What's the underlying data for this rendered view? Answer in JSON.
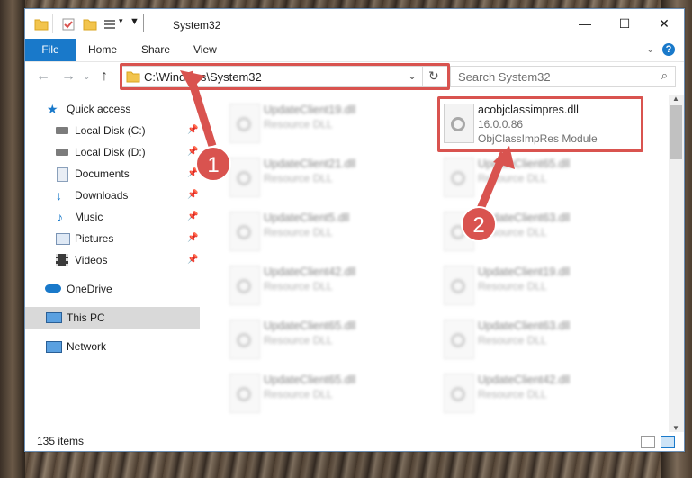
{
  "window": {
    "title": "System32"
  },
  "ribbon": {
    "tabs": [
      "File",
      "Home",
      "Share",
      "View"
    ]
  },
  "address": {
    "path": "C:\\Windows\\System32"
  },
  "search": {
    "placeholder": "Search System32"
  },
  "nav": {
    "items": [
      {
        "label": "Quick access",
        "icon": "star-icon",
        "color": "#1979ca"
      },
      {
        "label": "Local Disk (C:)",
        "icon": "drive-icon",
        "pinned": true
      },
      {
        "label": "Local Disk (D:)",
        "icon": "drive-icon",
        "pinned": true
      },
      {
        "label": "Documents",
        "icon": "documents-icon",
        "pinned": true
      },
      {
        "label": "Downloads",
        "icon": "downloads-icon",
        "pinned": true
      },
      {
        "label": "Music",
        "icon": "music-icon",
        "pinned": true
      },
      {
        "label": "Pictures",
        "icon": "pictures-icon",
        "pinned": true
      },
      {
        "label": "Videos",
        "icon": "videos-icon",
        "pinned": true
      },
      {
        "label": "OneDrive",
        "icon": "cloud-icon"
      },
      {
        "label": "This PC",
        "icon": "computer-icon",
        "selected": true
      },
      {
        "label": "Network",
        "icon": "network-icon"
      }
    ]
  },
  "files": [
    {
      "name": "UpdateClient19.dll",
      "desc": "Resource DLL"
    },
    {
      "name": "acobjclassimpres.dll",
      "version": "16.0.0.86",
      "desc": "ObjClassImpRes Module"
    },
    {
      "name": "UpdateClient21.dll",
      "desc": "Resource DLL"
    },
    {
      "name": "UpdateClient65.dll",
      "desc": "Resource DLL"
    },
    {
      "name": "UpdateClient5.dll",
      "desc": "Resource DLL"
    },
    {
      "name": "UpdateClient63.dll",
      "desc": "Resource DLL"
    },
    {
      "name": "UpdateClient42.dll",
      "desc": "Resource DLL"
    },
    {
      "name": "UpdateClient19.dll",
      "desc": "Resource DLL"
    },
    {
      "name": "UpdateClient65.dll",
      "desc": "Resource DLL"
    },
    {
      "name": "UpdateClient63.dll",
      "desc": "Resource DLL"
    },
    {
      "name": "UpdateClient65.dll",
      "desc": "Resource DLL"
    },
    {
      "name": "UpdateClient42.dll",
      "desc": "Resource DLL"
    }
  ],
  "status": {
    "count": "135 items"
  },
  "annotations": {
    "marker1": "1",
    "marker2": "2",
    "accent": "#d9534f"
  }
}
